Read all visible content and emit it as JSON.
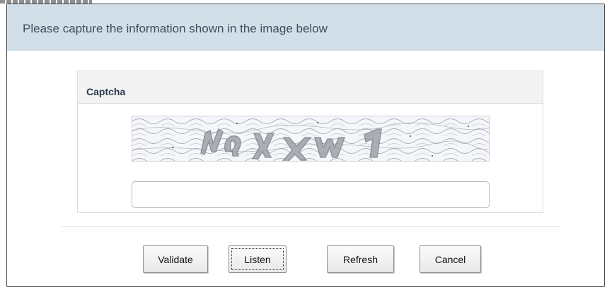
{
  "dialog": {
    "title": "Please capture the information shown in the image below",
    "header_color": "#d2dfe8"
  },
  "captcha_panel": {
    "heading": "Captcha",
    "image_icon": "captcha-image",
    "input_value": "",
    "input_placeholder": ""
  },
  "buttons": {
    "validate": "Validate",
    "listen": "Listen",
    "refresh": "Refresh",
    "cancel": "Cancel",
    "focused": "Listen"
  }
}
